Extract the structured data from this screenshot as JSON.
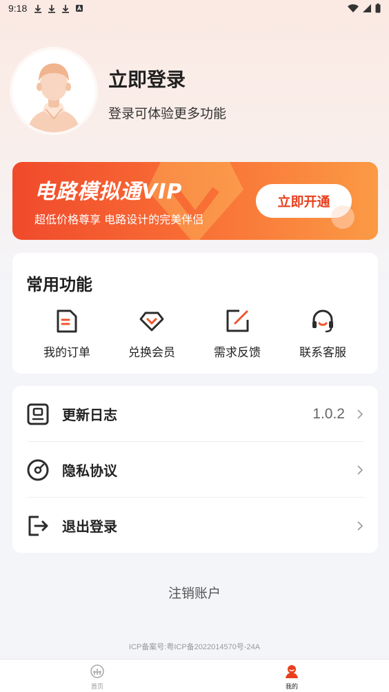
{
  "status_bar": {
    "time": "9:18"
  },
  "profile": {
    "title": "立即登录",
    "subtitle": "登录可体验更多功能"
  },
  "vip": {
    "title": "电路模拟通VIP",
    "subtitle": "超低价格尊享  电路设计的完美伴侣",
    "button": "立即开通",
    "accent_color": "#f04a2c"
  },
  "functions": {
    "title": "常用功能",
    "items": [
      {
        "label": "我的订单",
        "icon": "order-icon"
      },
      {
        "label": "兑换会员",
        "icon": "diamond-icon"
      },
      {
        "label": "需求反馈",
        "icon": "edit-icon"
      },
      {
        "label": "联系客服",
        "icon": "headset-icon"
      }
    ]
  },
  "list": {
    "items": [
      {
        "label": "更新日志",
        "value": "1.0.2",
        "icon": "log-icon"
      },
      {
        "label": "隐私协议",
        "icon": "privacy-icon"
      },
      {
        "label": "退出登录",
        "icon": "logout-icon"
      }
    ]
  },
  "cancel_account": "注销账户",
  "icp": "ICP备案号:粤ICP备2022014570号-24A",
  "tabs": [
    {
      "label": "首页",
      "icon": "home-icon"
    },
    {
      "label": "我的",
      "icon": "user-icon"
    }
  ]
}
